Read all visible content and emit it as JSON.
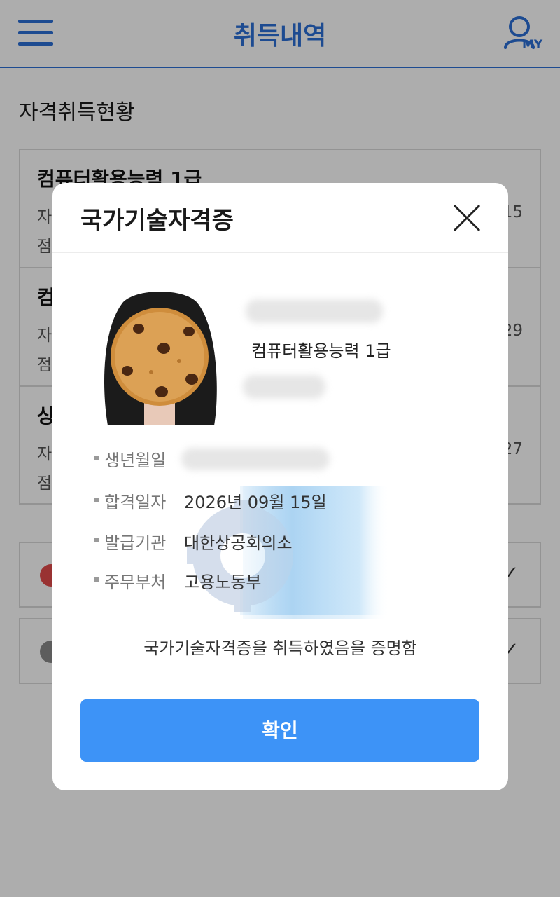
{
  "header": {
    "title": "취득내역",
    "my_label": "MY"
  },
  "section_title": "자격취득현황",
  "list_items": [
    {
      "name": "컴퓨터활용능력 1급",
      "sub1": "자",
      "sub2": "점",
      "date": "15"
    },
    {
      "name": "컴",
      "sub1": "자",
      "sub2": "점",
      "date": "29"
    },
    {
      "name": "상",
      "sub1": "자",
      "sub2": "점",
      "date": "27"
    }
  ],
  "modal": {
    "title": "국가기술자격증",
    "cert_name": "컴퓨터활용능력 1급",
    "fields": [
      {
        "label": "생년월일",
        "value": ""
      },
      {
        "label": "합격일자",
        "value": "2026년 09월 15일"
      },
      {
        "label": "발급기관",
        "value": "대한상공회의소"
      },
      {
        "label": "주무부처",
        "value": "고용노동부"
      }
    ],
    "statement": "국가기술자격증을 취득하였음을 증명함",
    "confirm_label": "확인"
  },
  "colors": {
    "brand_blue": "#2b6fd6",
    "button_blue": "#3d93f7",
    "dim_overlay": "rgba(0,0,0,0.32)"
  }
}
